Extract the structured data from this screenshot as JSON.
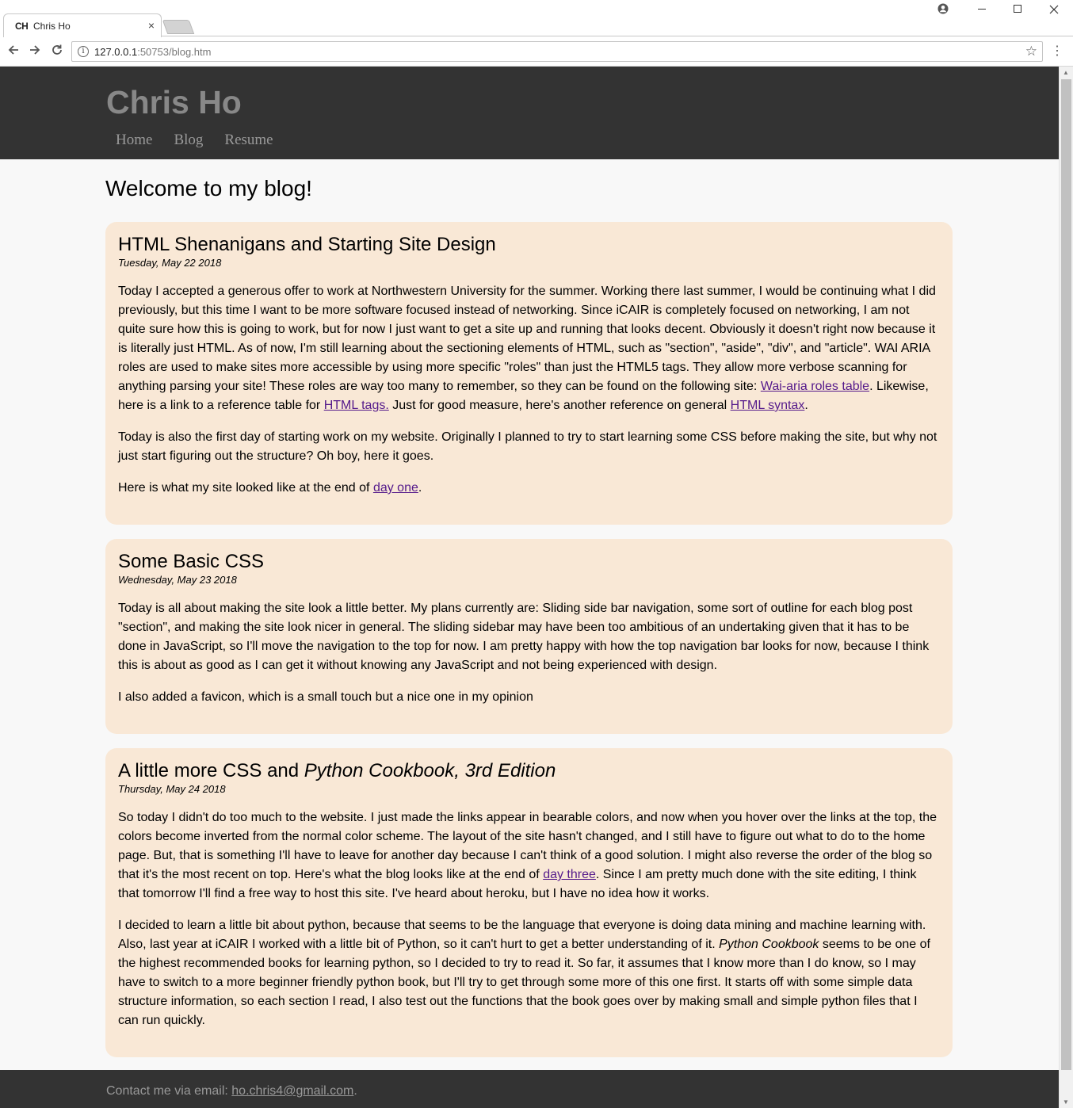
{
  "browser": {
    "tab_favicon": "CH",
    "tab_title": "Chris Ho",
    "tab_close": "×",
    "url_host": "127.0.0.1",
    "url_rest": ":50753/blog.htm",
    "icons": {
      "back": "back-arrow-icon",
      "forward": "forward-arrow-icon",
      "reload": "reload-icon",
      "info": "info-icon",
      "bookmark": "star-icon",
      "menu": "kebab-menu-icon",
      "profile": "profile-icon",
      "minimize": "minimize-icon",
      "maximize": "maximize-icon",
      "close": "close-icon"
    }
  },
  "site": {
    "title": "Chris Ho",
    "nav": [
      "Home",
      "Blog",
      "Resume"
    ]
  },
  "page": {
    "heading": "Welcome to my blog!"
  },
  "posts": [
    {
      "title": "HTML Shenanigans and Starting Site Design",
      "date": "Tuesday, May 22 2018",
      "p1_text": "Today I accepted a generous offer to work at Northwestern University for the summer. Working there last summer, I would be continuing what I did previously, but this time I want to be more software focused instead of networking. Since iCAIR is completely focused on networking, I am not quite sure how this is going to work, but for now I just want to get a site up and running that looks decent. Obviously it doesn't right now because it is literally just HTML. As of now, I'm still learning about the sectioning elements of HTML, such as \"section\", \"aside\", \"div\", and \"article\". WAI ARIA roles are used to make sites more accessible by using more specific \"roles\" than just the HTML5 tags. They allow more verbose scanning for anything parsing your site! These roles are way too many to remember, so they can be found on the following site: ",
      "p1_link1": "Wai-aria roles table",
      "p1_mid1": ". Likewise, here is a link to a reference table for ",
      "p1_link2": "HTML tags.",
      "p1_mid2": " Just for good measure, here's another reference on general ",
      "p1_link3": "HTML syntax",
      "p1_end": ".",
      "p2": "Today is also the first day of starting work on my website. Originally I planned to try to start learning some CSS before making the site, but why not just start figuring out the structure? Oh boy, here it goes.",
      "p3_text": "Here is what my site looked like at the end of ",
      "p3_link": "day one",
      "p3_end": "."
    },
    {
      "title": "Some Basic CSS",
      "date": "Wednesday, May 23 2018",
      "p1": "Today is all about making the site look a little better. My plans currently are: Sliding side bar navigation, some sort of outline for each blog post \"section\", and making the site look nicer in general. The sliding sidebar may have been too ambitious of an undertaking given that it has to be done in JavaScript, so I'll move the navigation to the top for now. I am pretty happy with how the top navigation bar looks for now, because I think this is about as good as I can get it without knowing any JavaScript and not being experienced with design.",
      "p2": "I also added a favicon, which is a small touch but a nice one in my opinion"
    },
    {
      "title_plain": "A little more CSS and ",
      "title_italic": "Python Cookbook, 3rd Edition",
      "date": "Thursday, May 24 2018",
      "p1_text": "So today I didn't do too much to the website. I just made the links appear in bearable colors, and now when you hover over the links at the top, the colors become inverted from the normal color scheme. The layout of the site hasn't changed, and I still have to figure out what to do to the home page. But, that is something I'll have to leave for another day because I can't think of a good solution. I might also reverse the order of the blog so that it's the most recent on top. Here's what the blog looks like at the end of ",
      "p1_link": "day three",
      "p1_end": ". Since I am pretty much done with the site editing, I think that tomorrow I'll find a free way to host this site. I've heard about heroku, but I have no idea how it works.",
      "p2_start": "I decided to learn a little bit about python, because that seems to be the language that everyone is doing data mining and machine learning with. Also, last year at iCAIR I worked with a little bit of Python, so it can't hurt to get a better understanding of it. ",
      "p2_italic": "Python Cookbook",
      "p2_end": " seems to be one of the highest recommended books for learning python, so I decided to try to read it. So far, it assumes that I know more than I do know, so I may have to switch to a more beginner friendly python book, but I'll try to get through some more of this one first. It starts off with some simple data structure information, so each section I read, I also test out the functions that the book goes over by making small and simple python files that I can run quickly."
    }
  ],
  "footer": {
    "text": "Contact me via email: ",
    "email": "ho.chris4@gmail.com",
    "end": "."
  },
  "colors": {
    "header_bg": "#333333",
    "post_bg": "#f9e8d6",
    "page_bg": "#f8f8f8",
    "link": "#551a8b",
    "nav_text": "#999999"
  }
}
